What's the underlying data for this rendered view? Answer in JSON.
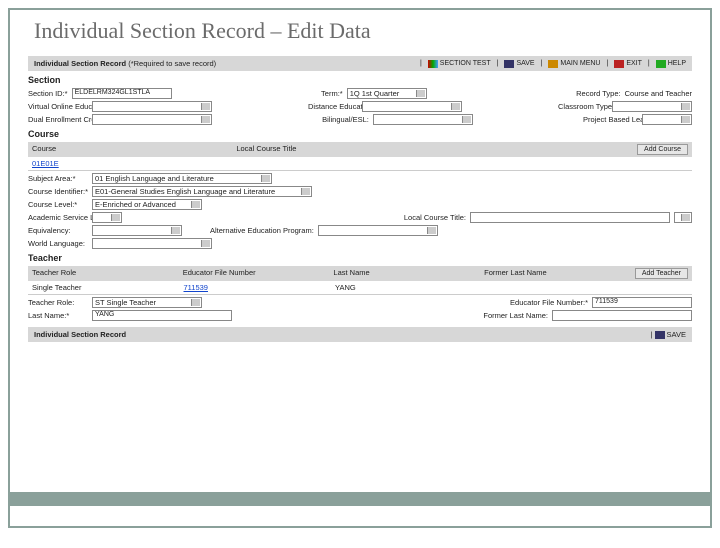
{
  "page_title": "Individual Section Record – Edit Data",
  "header": {
    "title": "Individual Section Record",
    "required_note": "(*Required to save record)",
    "buttons": {
      "section_test": "SECTION TEST",
      "save": "SAVE",
      "main_menu": "MAIN MENU",
      "exit": "EXIT",
      "help": "HELP"
    }
  },
  "section": {
    "heading": "Section",
    "id_label": "Section ID:*",
    "id_value": "ELDELRM324GL1STLA",
    "term_label": "Term:*",
    "term_value": "1Q 1st Quarter",
    "record_type_label": "Record Type:",
    "record_type_value": "Course and Teacher",
    "virtual_label": "Virtual Online Education:",
    "distance_label": "Distance Education:",
    "classroom_label": "Classroom Type:",
    "dual_label": "Dual Enrollment Credit:",
    "bilingual_label": "Bilingual/ESL:",
    "project_label": "Project Based Learning:"
  },
  "course": {
    "heading": "Course",
    "table": {
      "course": "Course",
      "local_title": "Local Course Title",
      "add": "Add Course",
      "link": "01E01E"
    },
    "subject_label": "Subject Area:*",
    "subject_value": "01 English Language and Literature",
    "identifier_label": "Course Identifier:*",
    "identifier_value": "E01-General Studies English Language and Literature",
    "level_label": "Course Level:*",
    "level_value": "E-Enriched or Advanced",
    "asl_label": "Academic Service Learning:",
    "local_title_label": "Local Course Title:",
    "equivalency_label": "Equivalency:",
    "altprog_label": "Alternative Education Program:",
    "worldlang_label": "World Language:"
  },
  "teacher": {
    "heading": "Teacher",
    "table": {
      "role": "Teacher Role",
      "efn": "Educator File Number",
      "last": "Last Name",
      "former": "Former Last Name",
      "add": "Add Teacher",
      "row": {
        "role": "Single Teacher",
        "efn": "711539",
        "last": "YANG",
        "former": ""
      }
    },
    "role_label": "Teacher Role:",
    "role_value": "ST Single Teacher",
    "efn_label": "Educator File Number:*",
    "efn_value": "711539",
    "last_label": "Last Name:*",
    "last_value": "YANG",
    "former_label": "Former Last Name:"
  },
  "footer": {
    "title": "Individual Section Record",
    "save": "SAVE"
  }
}
